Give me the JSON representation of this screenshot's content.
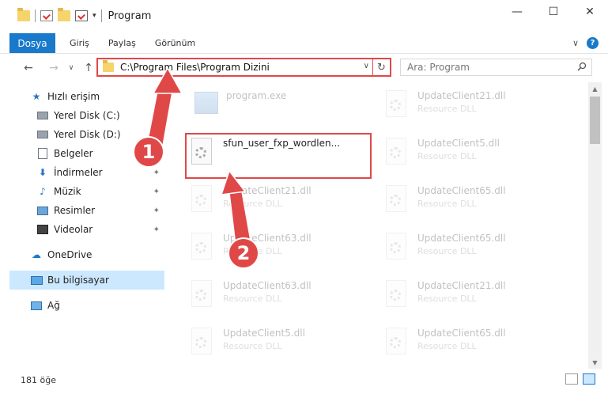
{
  "window": {
    "title": "Program",
    "controls": {
      "minimize": "—",
      "maximize": "☐",
      "close": "✕"
    }
  },
  "ribbon": {
    "file_tab": "Dosya",
    "tabs": [
      "Giriş",
      "Paylaş",
      "Görünüm"
    ],
    "expand": "∨",
    "help": "?"
  },
  "address": {
    "back": "←",
    "forward": "→",
    "recent": "∨",
    "up": "↑",
    "path": "C:\\Program Files\\Program Dizini",
    "dropdown": "∨",
    "refresh": "↻",
    "search_placeholder": "Ara: Program",
    "search_icon": "search-icon"
  },
  "sidebar": {
    "items": [
      {
        "label": "Hızlı erişim",
        "icon": "star-icon"
      },
      {
        "label": "Yerel Disk (C:)",
        "icon": "drive-icon"
      },
      {
        "label": "Yerel Disk (D:)",
        "icon": "drive-icon"
      },
      {
        "label": "Belgeler",
        "icon": "documents-icon"
      },
      {
        "label": "İndirmeler",
        "icon": "download-icon",
        "pinned": true
      },
      {
        "label": "Müzik",
        "icon": "music-icon",
        "pinned": true
      },
      {
        "label": "Resimler",
        "icon": "pictures-icon",
        "pinned": true
      },
      {
        "label": "Videolar",
        "icon": "videos-icon",
        "pinned": true
      },
      {
        "label": "OneDrive",
        "icon": "cloud-icon"
      },
      {
        "label": "Bu bilgisayar",
        "icon": "computer-icon",
        "selected": true
      },
      {
        "label": "Ağ",
        "icon": "network-icon"
      }
    ],
    "pin_glyph": "📌"
  },
  "files": {
    "left": [
      {
        "name": "program.exe",
        "type": ""
      },
      {
        "name": "sfun_user_fxp_wordlen...",
        "type": ""
      },
      {
        "name": "UpdateClient21.dll",
        "type": "Resource DLL"
      },
      {
        "name": "UpdateClient63.dll",
        "type": "Resource DLL"
      },
      {
        "name": "UpdateClient63.dll",
        "type": "Resource DLL"
      },
      {
        "name": "UpdateClient5.dll",
        "type": "Resource DLL"
      }
    ],
    "right": [
      {
        "name": "UpdateClient21.dll",
        "type": "Resource DLL"
      },
      {
        "name": "UpdateClient5.dll",
        "type": "Resource DLL"
      },
      {
        "name": "UpdateClient65.dll",
        "type": "Resource DLL"
      },
      {
        "name": "UpdateClient65.dll",
        "type": "Resource DLL"
      },
      {
        "name": "UpdateClient21.dll",
        "type": "Resource DLL"
      },
      {
        "name": "UpdateClient65.dll",
        "type": "Resource DLL"
      }
    ]
  },
  "annotations": {
    "badge1": "1",
    "badge2": "2",
    "color": "#e04848"
  },
  "status": {
    "count": "181 öğe"
  },
  "colors": {
    "accent": "#1979ca",
    "selected": "#cce8ff",
    "highlight": "#e04848"
  }
}
